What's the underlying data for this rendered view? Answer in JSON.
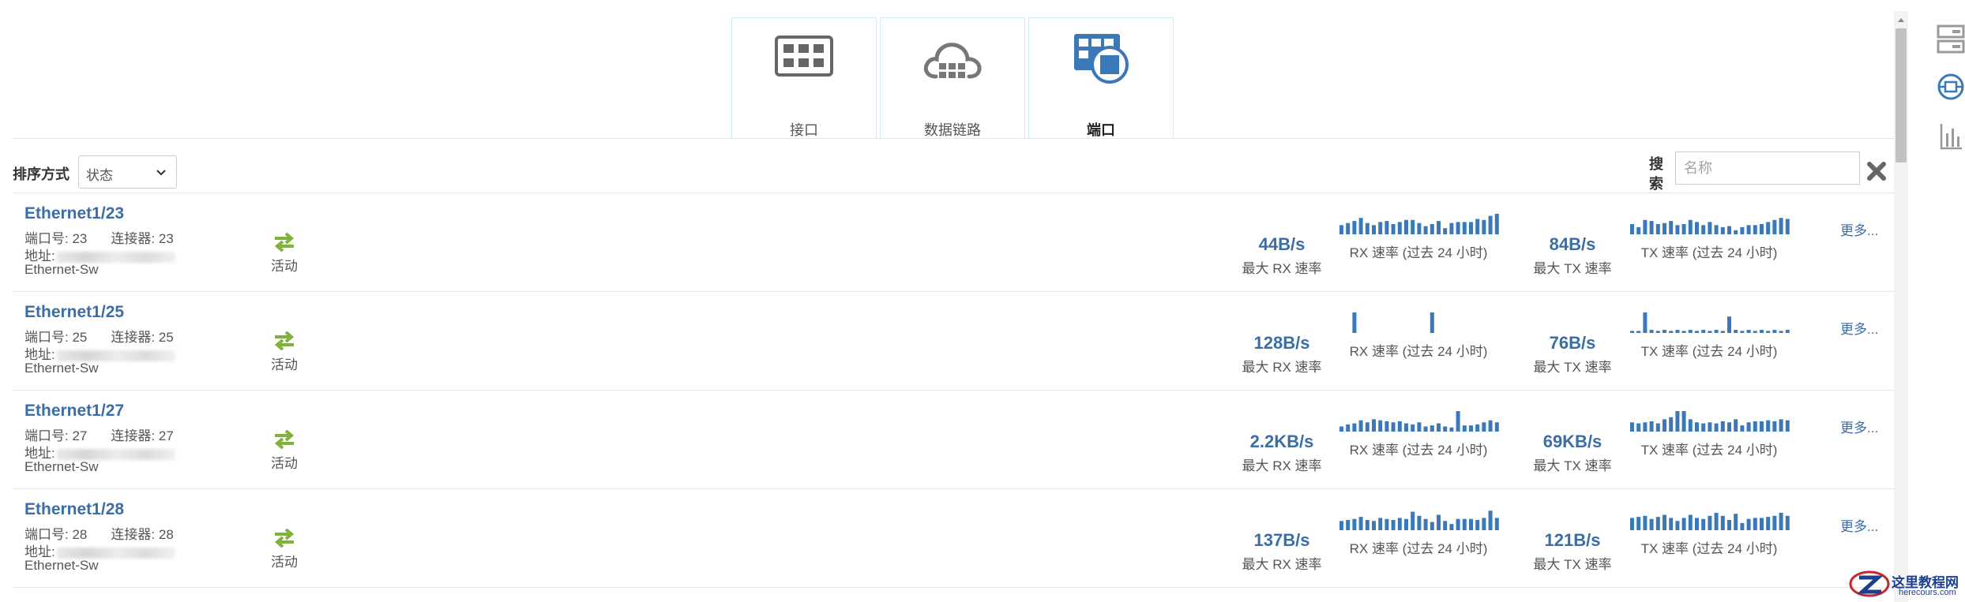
{
  "tabs": [
    {
      "label": "接口",
      "icon": "grid-icon",
      "active": false
    },
    {
      "label": "数据链路",
      "icon": "cloud-grid-icon",
      "active": false
    },
    {
      "label": "端口",
      "icon": "port-icon",
      "active": true
    }
  ],
  "sort": {
    "label": "排序方式",
    "value": "状态"
  },
  "search": {
    "label": "搜索",
    "placeholder": "名称"
  },
  "labels": {
    "port_no": "端口号:",
    "connector": "连接器:",
    "address": "地址:",
    "max_rx": "最大 RX 速率",
    "rx_24h": "RX 速率 (过去 24 小时)",
    "max_tx": "最大 TX 速率",
    "tx_24h": "TX 速率 (过去 24 小时)",
    "more": "更多..."
  },
  "colors": {
    "accent": "#3a6ea5",
    "active_green": "#7fb23a",
    "bar": "#3a78b8"
  },
  "rows": [
    {
      "name": "Ethernet1/23",
      "port": "23",
      "connector": "23",
      "addr_visible": "",
      "type": "Ethernet-Sw",
      "status": "活动",
      "max_rx": "44B/s",
      "max_tx": "84B/s",
      "rx_bars": [
        0.45,
        0.55,
        0.65,
        0.8,
        0.55,
        0.45,
        0.6,
        0.65,
        0.5,
        0.6,
        0.7,
        0.7,
        0.55,
        0.4,
        0.5,
        0.65,
        0.3,
        0.55,
        0.6,
        0.6,
        0.6,
        0.75,
        0.7,
        0.9,
        1.0
      ],
      "tx_bars": [
        0.5,
        0.35,
        0.7,
        0.65,
        0.5,
        0.55,
        0.65,
        0.45,
        0.5,
        0.7,
        0.6,
        0.45,
        0.6,
        0.45,
        0.35,
        0.4,
        0.2,
        0.35,
        0.45,
        0.45,
        0.5,
        0.6,
        0.7,
        0.8,
        0.75
      ]
    },
    {
      "name": "Ethernet1/25",
      "port": "25",
      "connector": "25",
      "addr_visible": "",
      "type": "Ethernet-Sw",
      "status": "活动",
      "max_rx": "128B/s",
      "max_tx": "76B/s",
      "rx_bars": [
        0,
        0,
        1.0,
        0,
        0,
        0,
        0,
        0,
        0,
        0,
        0,
        0,
        0,
        0,
        1.0,
        0,
        0,
        0,
        0,
        0,
        0,
        0,
        0,
        0,
        0
      ],
      "tx_bars": [
        0.1,
        0.1,
        1.0,
        0.15,
        0.1,
        0.15,
        0.1,
        0.15,
        0.1,
        0.15,
        0.1,
        0.15,
        0.1,
        0.15,
        0.1,
        0.8,
        0.15,
        0.1,
        0.15,
        0.1,
        0.15,
        0.1,
        0.15,
        0.1,
        0.15
      ]
    },
    {
      "name": "Ethernet1/27",
      "port": "27",
      "connector": "27",
      "addr_visible": "",
      "type": "Ethernet-Sw",
      "status": "活动",
      "max_rx": "2.2KB/s",
      "max_tx": "69KB/s",
      "rx_bars": [
        0.25,
        0.35,
        0.4,
        0.55,
        0.45,
        0.6,
        0.55,
        0.5,
        0.45,
        0.5,
        0.4,
        0.35,
        0.45,
        0.25,
        0.3,
        0.4,
        0.25,
        0.2,
        1.0,
        0.3,
        0.3,
        0.35,
        0.45,
        0.55,
        0.45
      ],
      "tx_bars": [
        0.45,
        0.4,
        0.45,
        0.5,
        0.4,
        0.6,
        0.7,
        1.0,
        1.0,
        0.6,
        0.45,
        0.4,
        0.45,
        0.4,
        0.5,
        0.45,
        0.6,
        0.3,
        0.45,
        0.5,
        0.5,
        0.55,
        0.5,
        0.6,
        0.55
      ]
    },
    {
      "name": "Ethernet1/28",
      "port": "28",
      "connector": "28",
      "addr_visible": "",
      "type": "Ethernet-Sw",
      "status": "活动",
      "max_rx": "137B/s",
      "max_tx": "121B/s",
      "rx_bars": [
        0.45,
        0.5,
        0.55,
        0.65,
        0.5,
        0.45,
        0.6,
        0.55,
        0.5,
        0.6,
        0.55,
        0.9,
        0.7,
        0.55,
        0.4,
        0.75,
        0.45,
        0.3,
        0.55,
        0.55,
        0.55,
        0.5,
        0.6,
        0.95,
        0.6
      ],
      "tx_bars": [
        0.6,
        0.65,
        0.7,
        0.55,
        0.65,
        0.75,
        0.6,
        0.45,
        0.6,
        0.75,
        0.6,
        0.55,
        0.7,
        0.85,
        0.7,
        0.5,
        0.8,
        0.35,
        0.55,
        0.6,
        0.6,
        0.65,
        0.7,
        0.85,
        0.7
      ]
    }
  ],
  "watermark": {
    "title": "这里教程网",
    "sub": "herecours.com"
  }
}
